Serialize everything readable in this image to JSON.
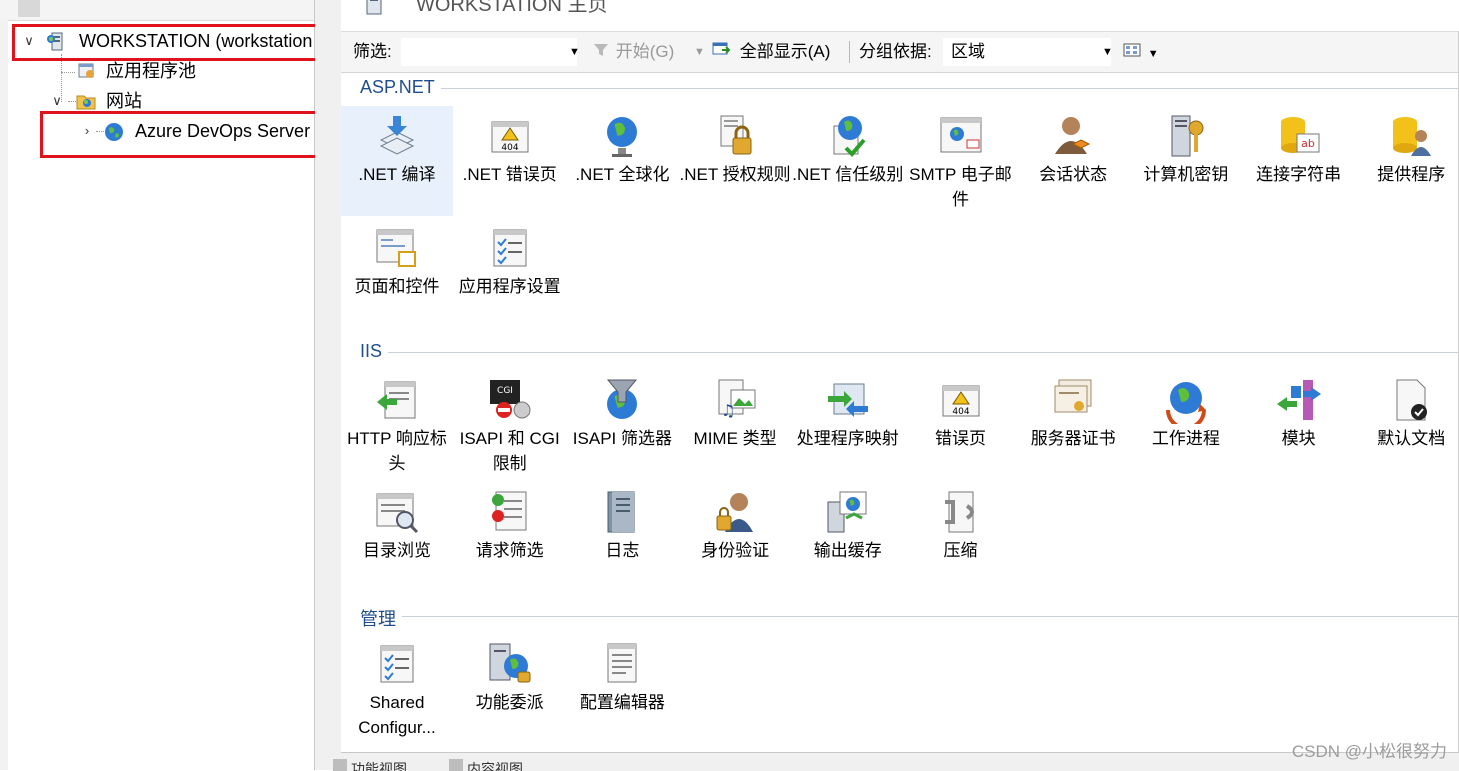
{
  "header": {
    "title": "WORKSTATION 主页"
  },
  "tree": {
    "items": [
      {
        "label": "WORKSTATION (workstation",
        "expanded": true,
        "icon": "server-icon"
      },
      {
        "label": "应用程序池",
        "icon": "app-pool-icon"
      },
      {
        "label": "网站",
        "expanded": true,
        "icon": "sites-folder-icon"
      },
      {
        "label": "Azure DevOps Server",
        "expanded": false,
        "icon": "globe-icon"
      }
    ]
  },
  "toolbar": {
    "filter_label": "筛选:",
    "filter_value": "",
    "start_label": "开始(G)",
    "show_all_label": "全部显示(A)",
    "group_by_label": "分组依据:",
    "group_by_value": "区域"
  },
  "sections": {
    "aspnet": {
      "title": "ASP.NET",
      "items": [
        {
          "label": ".NET 编译",
          "icon": "compile-icon",
          "selected": true
        },
        {
          "label": ".NET 错误页",
          "icon": "error-page-404-icon"
        },
        {
          "label": ".NET 全球化",
          "icon": "globe-icon"
        },
        {
          "label": ".NET 授权规则",
          "icon": "authorization-lock-icon"
        },
        {
          "label": ".NET 信任级别",
          "icon": "trust-level-icon"
        },
        {
          "label": "SMTP 电子邮件",
          "icon": "smtp-email-icon"
        },
        {
          "label": "会话状态",
          "icon": "session-state-icon"
        },
        {
          "label": "计算机密钥",
          "icon": "machine-key-icon"
        },
        {
          "label": "连接字符串",
          "icon": "connection-string-icon"
        },
        {
          "label": "提供程序",
          "icon": "providers-icon"
        },
        {
          "label": "页面和控件",
          "icon": "pages-controls-icon"
        },
        {
          "label": "应用程序设置",
          "icon": "app-settings-icon"
        }
      ]
    },
    "iis": {
      "title": "IIS",
      "items": [
        {
          "label": "HTTP 响应标头",
          "icon": "http-headers-icon"
        },
        {
          "label": "ISAPI 和 CGI 限制",
          "icon": "cgi-restrictions-icon"
        },
        {
          "label": "ISAPI 筛选器",
          "icon": "isapi-filter-icon"
        },
        {
          "label": "MIME 类型",
          "icon": "mime-types-icon"
        },
        {
          "label": "处理程序映射",
          "icon": "handler-mappings-icon"
        },
        {
          "label": "错误页",
          "icon": "error-page-404-icon"
        },
        {
          "label": "服务器证书",
          "icon": "certificates-icon"
        },
        {
          "label": "工作进程",
          "icon": "worker-process-icon"
        },
        {
          "label": "模块",
          "icon": "modules-icon"
        },
        {
          "label": "默认文档",
          "icon": "default-document-icon"
        },
        {
          "label": "目录浏览",
          "icon": "directory-browsing-icon"
        },
        {
          "label": "请求筛选",
          "icon": "request-filtering-icon"
        },
        {
          "label": "日志",
          "icon": "logging-icon"
        },
        {
          "label": "身份验证",
          "icon": "authentication-icon"
        },
        {
          "label": "输出缓存",
          "icon": "output-caching-icon"
        },
        {
          "label": "压缩",
          "icon": "compression-icon"
        }
      ]
    },
    "management": {
      "title": "管理",
      "items": [
        {
          "label": "Shared Configur...",
          "icon": "shared-config-icon"
        },
        {
          "label": "功能委派",
          "icon": "feature-delegation-icon"
        },
        {
          "label": "配置编辑器",
          "icon": "config-editor-icon"
        }
      ]
    }
  },
  "bottom_tabs": [
    "功能视图",
    "内容视图"
  ],
  "watermark": "CSDN @小松很努力",
  "colors": {
    "section_title": "#1f4e8c",
    "highlight_box": "#e0131c",
    "selection": "#e8f1fb"
  }
}
